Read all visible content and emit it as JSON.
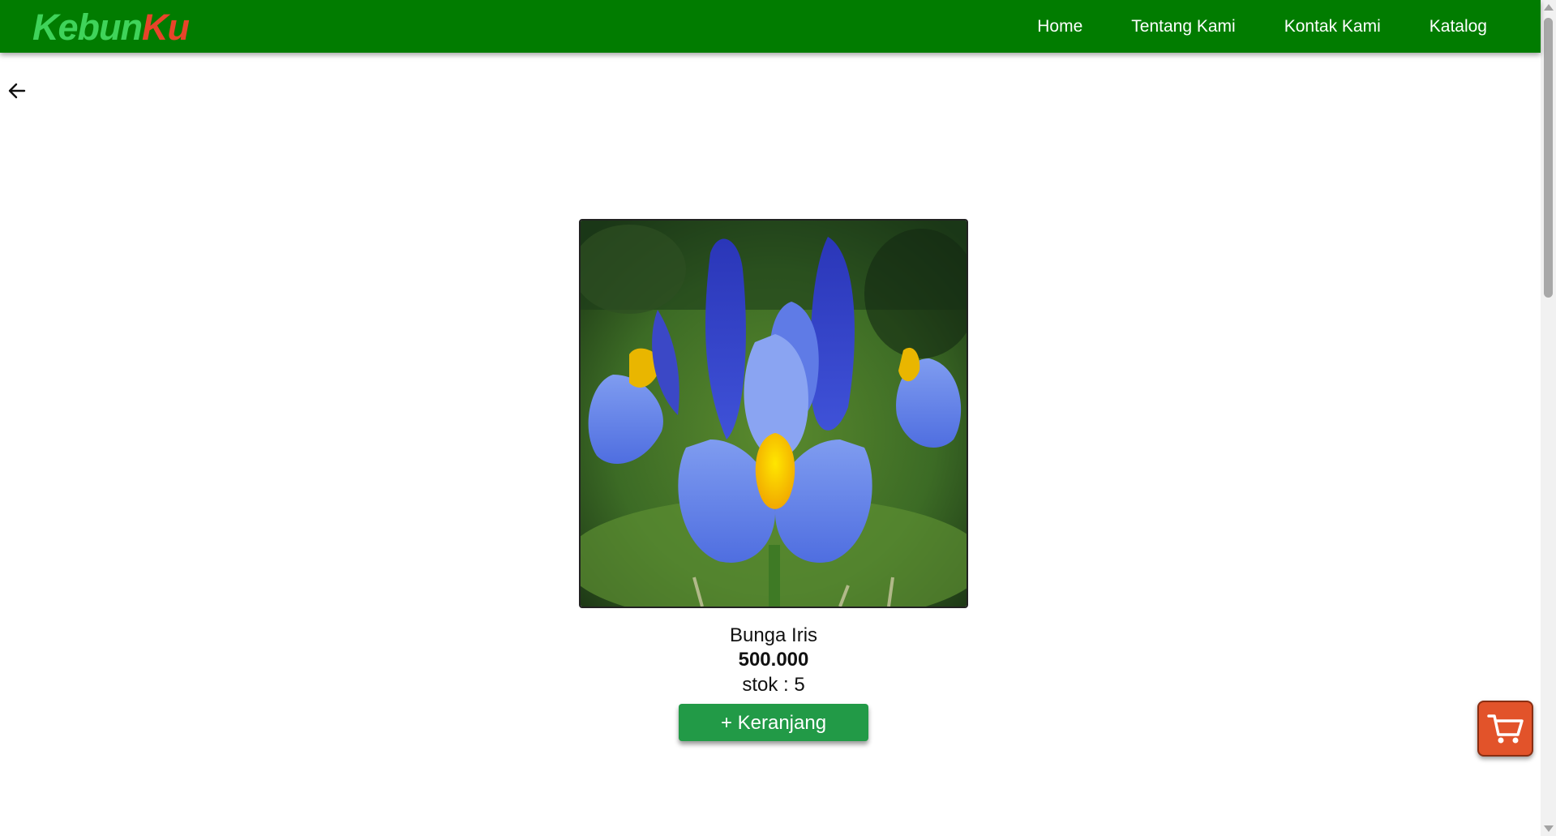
{
  "header": {
    "logo_part1": "Kebun",
    "logo_part2": "Ku",
    "nav": [
      {
        "label": "Home"
      },
      {
        "label": "Tentang Kami"
      },
      {
        "label": "Kontak Kami"
      },
      {
        "label": "Katalog"
      }
    ],
    "bg_color": "#017c00"
  },
  "back_icon": "arrow-left-icon",
  "product": {
    "name": "Bunga Iris",
    "price": "500.000",
    "stock": "stok : 5",
    "add_button_label": "+ Keranjang",
    "image_icon": "iris-flower-photo"
  },
  "cart_icon": "shopping-cart-icon",
  "colors": {
    "accent_green": "#229a47",
    "cart_orange": "#e2532a",
    "logo_green": "#3fd35a",
    "logo_red": "#e8442a"
  }
}
